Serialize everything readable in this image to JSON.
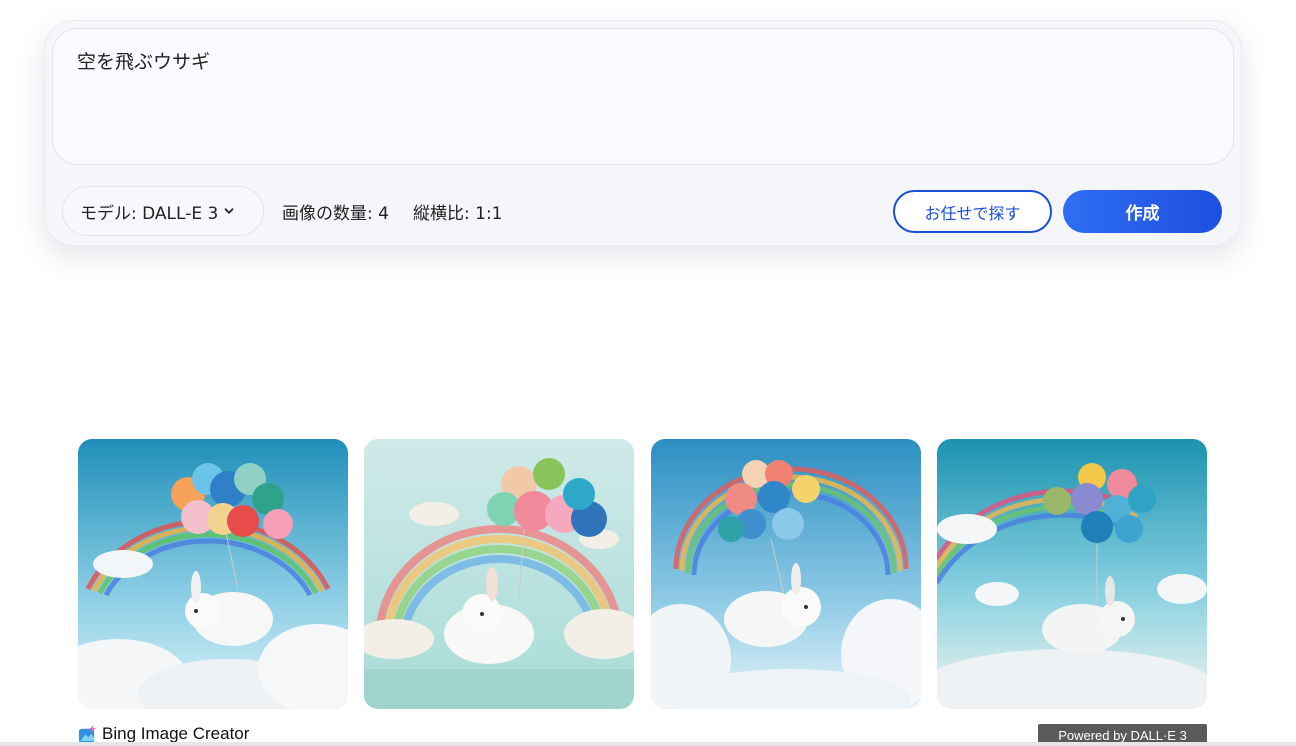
{
  "prompt": {
    "text": "空を飛ぶウサギ"
  },
  "options": {
    "model_label": "モデル: DALL-E 3",
    "image_count": "画像の数量: 4",
    "aspect_ratio": "縦横比: 1:1"
  },
  "buttons": {
    "surprise_label": "お任せで探す",
    "create_label": "作成"
  },
  "results": [
    {
      "icon": "rabbit-balloons-image"
    },
    {
      "icon": "rabbit-balloons-image"
    },
    {
      "icon": "rabbit-balloons-image"
    },
    {
      "icon": "rabbit-balloons-image"
    }
  ],
  "footer": {
    "brand": "Bing Image Creator",
    "powered_by": "Powered by DALL·E 3"
  },
  "colors": {
    "accent": "#1b4fd8",
    "create_button": "#2a62ec",
    "badge": "#5a5a5a"
  }
}
